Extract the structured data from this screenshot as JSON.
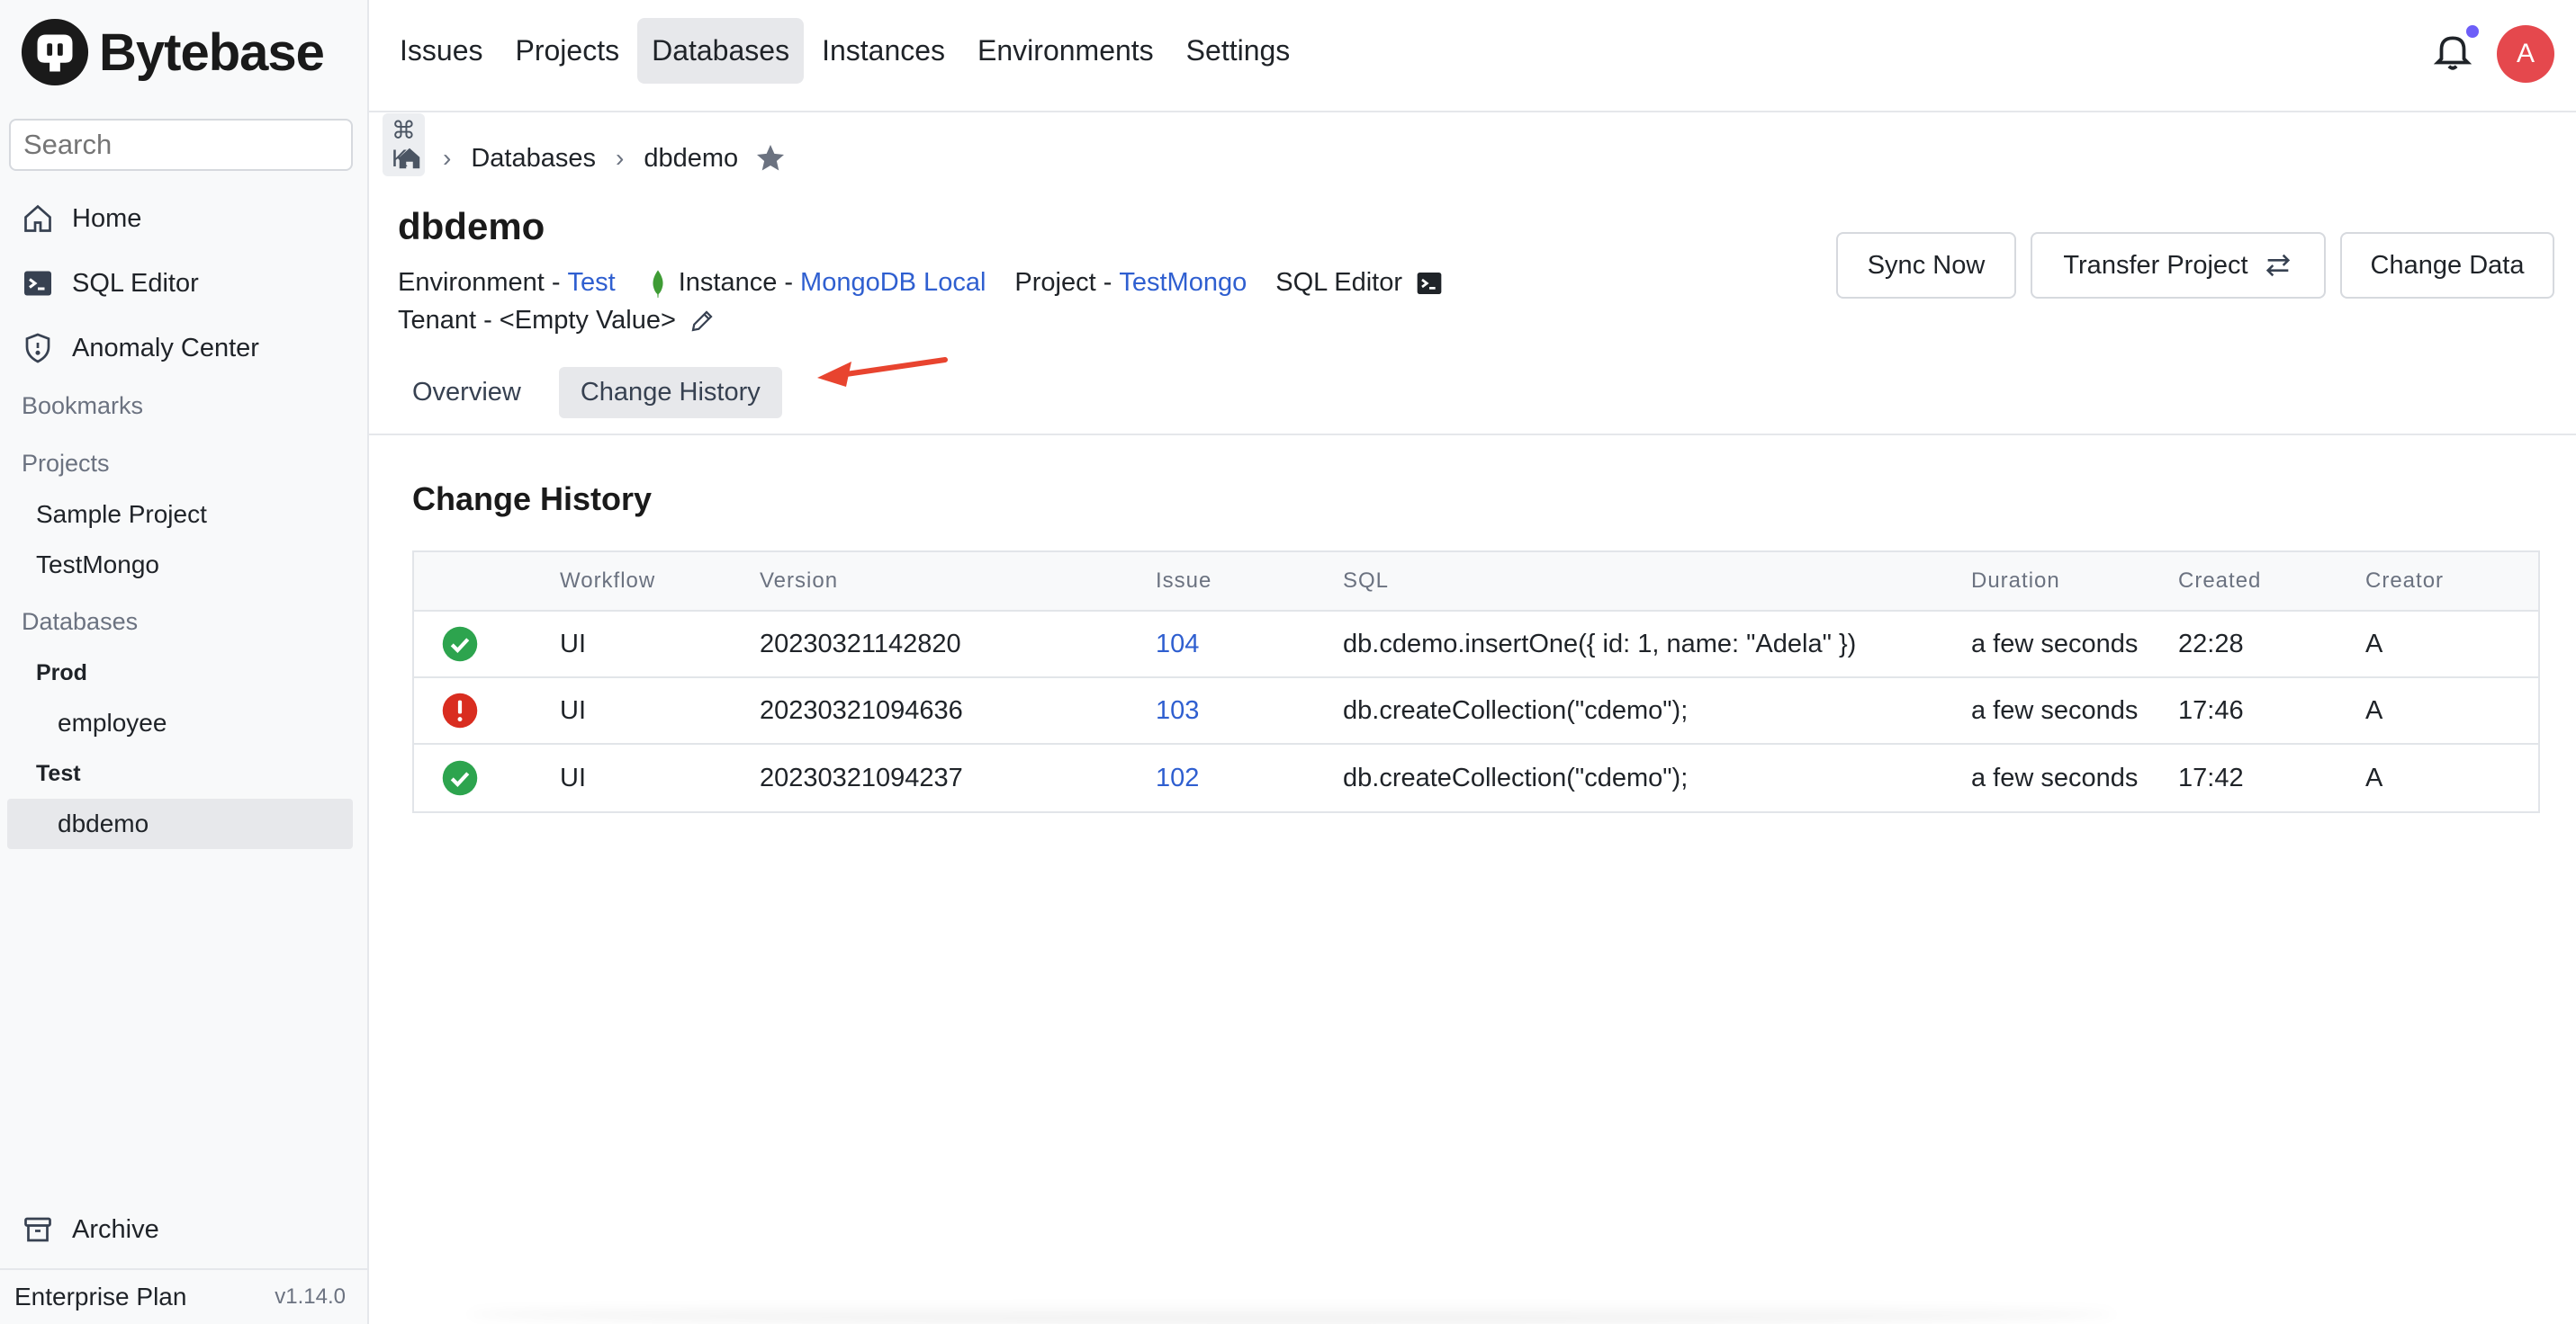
{
  "brand": {
    "name": "Bytebase"
  },
  "search": {
    "placeholder": "Search",
    "shortcut": "⌘ K"
  },
  "sidebar": {
    "nav": [
      {
        "label": "Home",
        "icon": "home-icon"
      },
      {
        "label": "SQL Editor",
        "icon": "terminal-icon"
      },
      {
        "label": "Anomaly Center",
        "icon": "shield-icon"
      }
    ],
    "bookmarks_label": "Bookmarks",
    "projects_label": "Projects",
    "projects": [
      "Sample Project",
      "TestMongo"
    ],
    "databases_label": "Databases",
    "environments": [
      {
        "name": "Prod",
        "databases": [
          "employee"
        ]
      },
      {
        "name": "Test",
        "databases": [
          "dbdemo"
        ]
      }
    ],
    "archive_label": "Archive",
    "plan": "Enterprise Plan",
    "version": "v1.14.0"
  },
  "topnav": {
    "items": [
      "Issues",
      "Projects",
      "Databases",
      "Instances",
      "Environments",
      "Settings"
    ],
    "active": "Databases"
  },
  "user": {
    "avatar_initial": "A"
  },
  "breadcrumb": {
    "section": "Databases",
    "current": "dbdemo"
  },
  "database": {
    "title": "dbdemo",
    "environment_label": "Environment - ",
    "environment": "Test",
    "instance_label": "Instance - ",
    "instance": "MongoDB Local",
    "project_label": "Project - ",
    "project": "TestMongo",
    "sql_editor_label": "SQL Editor",
    "tenant_label": "Tenant - ",
    "tenant": "<Empty Value>"
  },
  "actions": {
    "sync": "Sync Now",
    "transfer": "Transfer Project",
    "change_data": "Change Data"
  },
  "tabs": {
    "items": [
      "Overview",
      "Change History"
    ],
    "active": "Change History"
  },
  "history": {
    "title": "Change History",
    "columns": [
      "",
      "Workflow",
      "Version",
      "Issue",
      "SQL",
      "Duration",
      "Created",
      "Creator"
    ],
    "rows": [
      {
        "status": "success",
        "workflow": "UI",
        "version": "20230321142820",
        "issue": "104",
        "sql": "db.cdemo.insertOne({ id: 1, name: \"Adela\" })",
        "duration": "a few seconds",
        "created": "22:28",
        "creator": "A"
      },
      {
        "status": "failed",
        "workflow": "UI",
        "version": "20230321094636",
        "issue": "103",
        "sql": "db.createCollection(\"cdemo\");",
        "duration": "a few seconds",
        "created": "17:46",
        "creator": "A"
      },
      {
        "status": "success",
        "workflow": "UI",
        "version": "20230321094237",
        "issue": "102",
        "sql": "db.createCollection(\"cdemo\");",
        "duration": "a few seconds",
        "created": "17:42",
        "creator": "A"
      }
    ]
  },
  "colors": {
    "accent": "#2f5fd0",
    "success": "#2da44e",
    "error": "#d92d20",
    "annotation_arrow": "#e8442f"
  }
}
